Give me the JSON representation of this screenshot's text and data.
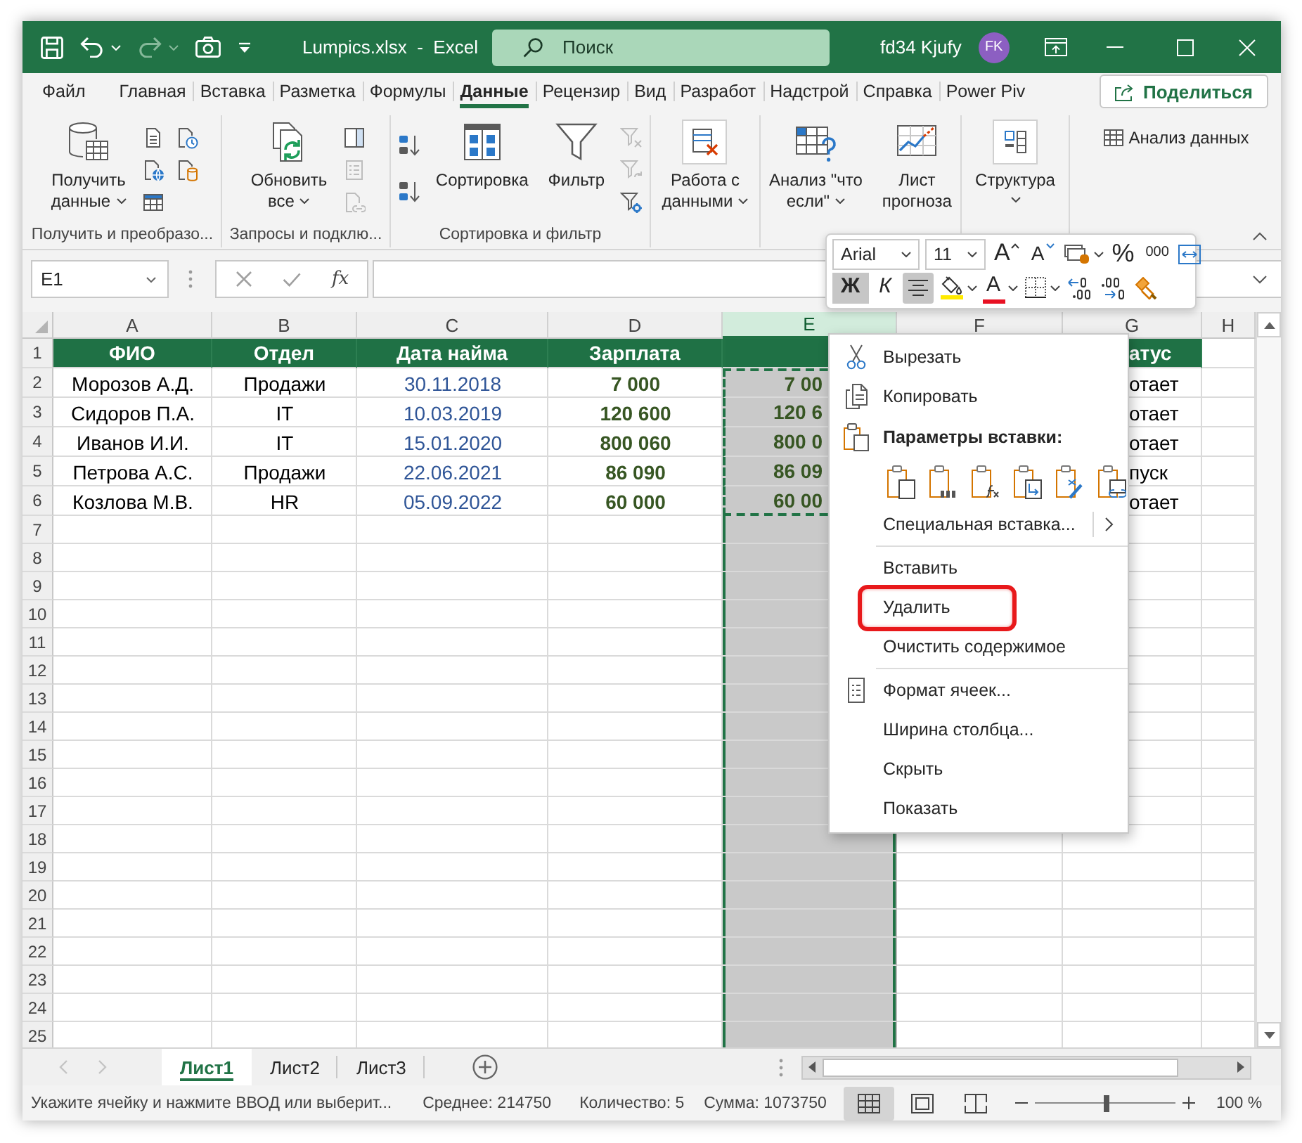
{
  "window": {
    "title": "Lumpics.xlsx  -  Excel",
    "user": "fd34 Kjufy",
    "avatar": "FK"
  },
  "quick_access": [
    {
      "kind": "save",
      "disabled": false,
      "dropdown": false
    },
    {
      "kind": "undo",
      "disabled": false,
      "dropdown": true
    },
    {
      "kind": "redo",
      "disabled": true,
      "dropdown": true
    },
    {
      "kind": "camera",
      "disabled": false,
      "dropdown": false
    },
    {
      "kind": "customize",
      "disabled": false,
      "dropdown": false
    }
  ],
  "search": {
    "placeholder": "Поиск"
  },
  "ribbon_tabs": [
    {
      "label": "Файл",
      "selected": false
    },
    {
      "label": "Главная",
      "selected": false
    },
    {
      "label": "Вставка",
      "selected": false
    },
    {
      "label": "Разметка",
      "selected": false
    },
    {
      "label": "Формулы",
      "selected": false
    },
    {
      "label": "Данные",
      "selected": true
    },
    {
      "label": "Рецензир",
      "selected": false
    },
    {
      "label": "Вид",
      "selected": false
    },
    {
      "label": "Разработ",
      "selected": false
    },
    {
      "label": "Надстрой",
      "selected": false
    },
    {
      "label": "Справка",
      "selected": false
    },
    {
      "label": "Power Piv",
      "selected": false
    }
  ],
  "share_button": "Поделиться",
  "ribbon_groups": [
    {
      "label": "Получить и преобразо...",
      "items": [
        {
          "kind": "get_data",
          "label": "Получить\nданные",
          "dropdown": true
        },
        {
          "kind": "stack",
          "items": [
            {
              "kind": "from_text",
              "disabled": false
            },
            {
              "kind": "from_web",
              "disabled": false
            },
            {
              "kind": "from_table",
              "disabled": false
            }
          ]
        },
        {
          "kind": "stack",
          "items": [
            {
              "kind": "recent_sources",
              "disabled": false
            },
            {
              "kind": "connections",
              "disabled": false
            }
          ]
        }
      ]
    },
    {
      "label": "Запросы и подклю...",
      "items": [
        {
          "kind": "refresh_all",
          "label": "Обновить\nвсе",
          "dropdown": true
        },
        {
          "kind": "stack",
          "items": [
            {
              "kind": "queries",
              "disabled": false
            },
            {
              "kind": "properties",
              "disabled": true
            },
            {
              "kind": "edit_links",
              "disabled": true
            }
          ]
        }
      ]
    },
    {
      "label": "Сортировка и фильтр",
      "items": [
        {
          "kind": "stack",
          "items": [
            {
              "kind": "sort_asc",
              "disabled": false
            },
            {
              "kind": "sort_desc",
              "disabled": false
            }
          ]
        },
        {
          "kind": "sort",
          "label": "Сортировка",
          "dropdown": false
        },
        {
          "kind": "filter",
          "label": "Фильтр",
          "dropdown": false
        },
        {
          "kind": "stack",
          "items": [
            {
              "kind": "clear_filter",
              "disabled": true
            },
            {
              "kind": "reapply",
              "disabled": true
            },
            {
              "kind": "advanced_filter",
              "disabled": false
            }
          ]
        }
      ]
    },
    {
      "items": [
        {
          "kind": "data_tools",
          "label": "Работа с\nданными",
          "dropdown": true
        }
      ]
    },
    {
      "items": [
        {
          "kind": "what_if",
          "label": "Анализ \"что\nесли\"",
          "dropdown": true
        },
        {
          "kind": "forecast_sheet",
          "label": "Лист\nпрогноза",
          "dropdown": false
        }
      ]
    },
    {
      "items": [
        {
          "kind": "outline",
          "label": "Структура",
          "dropdown": true
        }
      ]
    },
    {
      "items": [
        {
          "kind": "stack",
          "items": [
            {
              "kind": "data_analysis",
              "label": "Анализ данных",
              "disabled": false
            }
          ]
        }
      ]
    }
  ],
  "formula_bar": {
    "name_box": "E1",
    "function_button": "fx"
  },
  "mini_toolbar": {
    "font": "Arial",
    "font_size": "11",
    "row_1": [
      {
        "kind": "grow_font",
        "label": "A",
        "dropdown": false
      },
      {
        "kind": "shrink_font",
        "label": "A",
        "dropdown": false
      },
      {
        "kind": "accounting_format",
        "dropdown": true
      },
      {
        "kind": "percent",
        "label": "%",
        "dropdown": false
      },
      {
        "kind": "thousands",
        "label": "000",
        "dropdown": false
      },
      {
        "kind": "merge",
        "dropdown": false
      }
    ],
    "row_2": [
      {
        "kind": "bold",
        "label": "Ж",
        "pressed": true,
        "dropdown": false
      },
      {
        "kind": "italic",
        "label": "К",
        "pressed": false,
        "dropdown": false
      },
      {
        "kind": "align_center",
        "pressed": true,
        "dropdown": false
      },
      {
        "kind": "fill_color",
        "pressed": false,
        "dropdown": true
      },
      {
        "kind": "font_color",
        "label": "A",
        "pressed": false,
        "dropdown": true
      },
      {
        "kind": "borders",
        "pressed": false,
        "dropdown": true
      },
      {
        "kind": "increase_decimal",
        "pressed": false,
        "dropdown": false
      },
      {
        "kind": "decrease_decimal",
        "pressed": false,
        "dropdown": false
      },
      {
        "kind": "format_painter",
        "pressed": false,
        "dropdown": false
      }
    ]
  },
  "sheet": {
    "columns": [
      {
        "label": "A",
        "selected": false,
        "kind": "text"
      },
      {
        "label": "B",
        "selected": false,
        "kind": "text"
      },
      {
        "label": "C",
        "selected": false,
        "kind": "date"
      },
      {
        "label": "D",
        "selected": false,
        "kind": "amount"
      },
      {
        "label": "E",
        "selected": true,
        "kind": "amount"
      },
      {
        "label": "F",
        "selected": false,
        "kind": "text"
      },
      {
        "label": "G",
        "selected": false,
        "kind": "text"
      },
      {
        "label": "H",
        "selected": false,
        "kind": "text"
      }
    ],
    "rows": [
      {
        "number": "1",
        "kind": "header",
        "cells": [
          {
            "text": "ФИО"
          },
          {
            "text": "Отдел"
          },
          {
            "text": "Дата найма"
          },
          {
            "text": "Зарплата"
          },
          {},
          {},
          {
            "text": "атус"
          }
        ]
      },
      {
        "number": "2",
        "kind": "data",
        "cells": [
          {
            "text": "Морозов А.Д.",
            "copied": false
          },
          {
            "text": "Продажи",
            "copied": false
          },
          {
            "text": "30.11.2018",
            "copied": false
          },
          {
            "text": "7 000",
            "copied": false
          },
          {
            "text": "7 00",
            "copied": true
          },
          {},
          {
            "text": "отает",
            "copied": false
          }
        ]
      },
      {
        "number": "3",
        "kind": "data",
        "cells": [
          {
            "text": "Сидоров П.А.",
            "copied": false
          },
          {
            "text": "IT",
            "copied": false
          },
          {
            "text": "10.03.2019",
            "copied": false
          },
          {
            "text": "120 600",
            "copied": false
          },
          {
            "text": "120 6",
            "copied": true
          },
          {},
          {
            "text": "отает",
            "copied": false
          }
        ]
      },
      {
        "number": "4",
        "kind": "data",
        "cells": [
          {
            "text": "Иванов И.И.",
            "copied": false
          },
          {
            "text": "IT",
            "copied": false
          },
          {
            "text": "15.01.2020",
            "copied": false
          },
          {
            "text": "800 060",
            "copied": false
          },
          {
            "text": "800 0",
            "copied": true
          },
          {},
          {
            "text": "отает",
            "copied": false
          }
        ]
      },
      {
        "number": "5",
        "kind": "data",
        "cells": [
          {
            "text": "Петрова А.С.",
            "copied": false
          },
          {
            "text": "Продажи",
            "copied": false
          },
          {
            "text": "22.06.2021",
            "copied": false
          },
          {
            "text": "86 090",
            "copied": false
          },
          {
            "text": "86 09",
            "copied": true
          },
          {},
          {
            "text": "пуск",
            "copied": false
          }
        ]
      },
      {
        "number": "6",
        "kind": "data",
        "cells": [
          {
            "text": "Козлова М.В.",
            "copied": false
          },
          {
            "text": "HR",
            "copied": false
          },
          {
            "text": "05.09.2022",
            "copied": false
          },
          {
            "text": "60 000",
            "copied": false
          },
          {
            "text": "60 00",
            "copied": true
          },
          {},
          {
            "text": "отает",
            "copied": false
          }
        ]
      },
      {
        "number": "7",
        "kind": "data"
      },
      {
        "number": "8",
        "kind": "data"
      },
      {
        "number": "9",
        "kind": "data"
      },
      {
        "number": "10",
        "kind": "data"
      },
      {
        "number": "11",
        "kind": "data"
      },
      {
        "number": "12",
        "kind": "data"
      },
      {
        "number": "13",
        "kind": "data"
      },
      {
        "number": "14",
        "kind": "data"
      },
      {
        "number": "15",
        "kind": "data"
      },
      {
        "number": "16",
        "kind": "data"
      },
      {
        "number": "17",
        "kind": "data"
      },
      {
        "number": "18",
        "kind": "data"
      },
      {
        "number": "19",
        "kind": "data"
      },
      {
        "number": "20",
        "kind": "data"
      },
      {
        "number": "21",
        "kind": "data"
      },
      {
        "number": "22",
        "kind": "data"
      },
      {
        "number": "23",
        "kind": "data"
      },
      {
        "number": "24",
        "kind": "data"
      },
      {
        "number": "25",
        "kind": "data"
      }
    ]
  },
  "context_menu": {
    "items": [
      {
        "kind": "cut",
        "label": "Вырезать",
        "highlighted": false
      },
      {
        "kind": "copy",
        "label": "Копировать",
        "highlighted": false
      },
      {
        "kind": "heading",
        "label": "Параметры вставки:"
      },
      {
        "kind": "paste_options",
        "options": [
          {
            "kind": "paste"
          },
          {
            "kind": "values"
          },
          {
            "kind": "formulas"
          },
          {
            "kind": "transpose"
          },
          {
            "kind": "formatting"
          },
          {
            "kind": "link"
          }
        ]
      },
      {
        "kind": "submenu",
        "label": "Специальная вставка...",
        "highlighted": false
      },
      {
        "kind": "separator"
      },
      {
        "kind": "command",
        "label": "Вставить",
        "highlighted": false
      },
      {
        "kind": "command",
        "label": "Удалить",
        "highlighted": true
      },
      {
        "kind": "command",
        "label": "Очистить содержимое",
        "highlighted": false
      },
      {
        "kind": "separator"
      },
      {
        "kind": "format_cells",
        "label": "Формат ячеек...",
        "highlighted": false
      },
      {
        "kind": "command",
        "label": "Ширина столбца...",
        "highlighted": false
      },
      {
        "kind": "command",
        "label": "Скрыть",
        "highlighted": false
      },
      {
        "kind": "command",
        "label": "Показать",
        "highlighted": false
      }
    ]
  },
  "sheet_nav": [
    {
      "kind": "previous",
      "disabled": true
    },
    {
      "kind": "next",
      "disabled": true
    }
  ],
  "sheet_tabs": [
    {
      "label": "Лист1",
      "selected": true
    },
    {
      "label": "Лист2",
      "selected": false
    },
    {
      "label": "Лист3",
      "selected": false
    }
  ],
  "status_bar": {
    "message": "Укажите ячейку и нажмите ВВОД или выберит...",
    "average": "Среднее: 214750",
    "count": "Количество: 5",
    "sum": "Сумма: 1073750",
    "views": [
      {
        "kind": "normal",
        "selected": true
      },
      {
        "kind": "page_layout",
        "selected": false
      },
      {
        "kind": "page_break",
        "selected": false
      }
    ],
    "zoom": {
      "level": 0.51,
      "reading": "100 %"
    }
  }
}
